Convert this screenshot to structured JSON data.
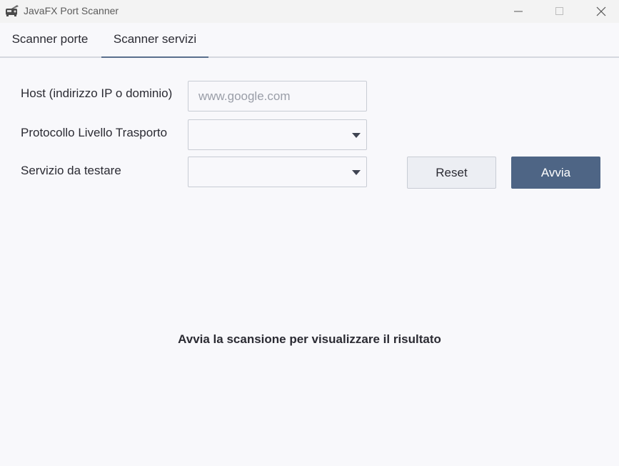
{
  "window": {
    "title": "JavaFX Port Scanner",
    "icon": "scanner-app-icon",
    "controls": [
      "minimize-icon",
      "maximize-icon",
      "close-icon"
    ]
  },
  "tabs": [
    {
      "label": "Scanner porte",
      "selected": false
    },
    {
      "label": "Scanner servizi",
      "selected": true
    }
  ],
  "form": {
    "host_label": "Host (indirizzo IP o dominio)",
    "host_value": "",
    "host_placeholder": "www.google.com",
    "protocol_label": "Protocollo Livello Trasporto",
    "protocol_value": "",
    "service_label": "Servizio da testare",
    "service_value": ""
  },
  "buttons": {
    "reset_label": "Reset",
    "start_label": "Avvia"
  },
  "status_text": "Avvia la scansione per visualizzare il risultato",
  "colors": {
    "accent": "#4e6585",
    "tab_indicator": "#5a6f8d",
    "background": "#f8f8fb"
  }
}
